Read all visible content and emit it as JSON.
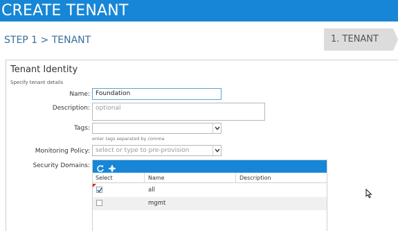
{
  "window": {
    "title": "CREATE TENANT"
  },
  "step": {
    "breadcrumb": "STEP 1 > TENANT",
    "tab_label": "1. TENANT"
  },
  "section": {
    "heading": "Tenant Identity",
    "subheading": "Specify tenant details"
  },
  "form": {
    "name": {
      "label": "Name:",
      "value": "Foundation"
    },
    "description": {
      "label": "Description:",
      "placeholder": "optional"
    },
    "tags": {
      "label": "Tags:",
      "value": "",
      "hint": "enter tags separated by comma"
    },
    "monitoring_policy": {
      "label": "Monitoring Policy:",
      "placeholder": "select or type to pre-provision"
    },
    "security_domains": {
      "label": "Security Domains:",
      "columns": [
        "Select",
        "Name",
        "Description"
      ],
      "rows": [
        {
          "name": "all",
          "description": "",
          "checked": true
        },
        {
          "name": "mgmt",
          "description": "",
          "checked": false
        }
      ]
    }
  },
  "colors": {
    "accent": "#1786d6",
    "breadcrumb": "#3a6e9c"
  }
}
